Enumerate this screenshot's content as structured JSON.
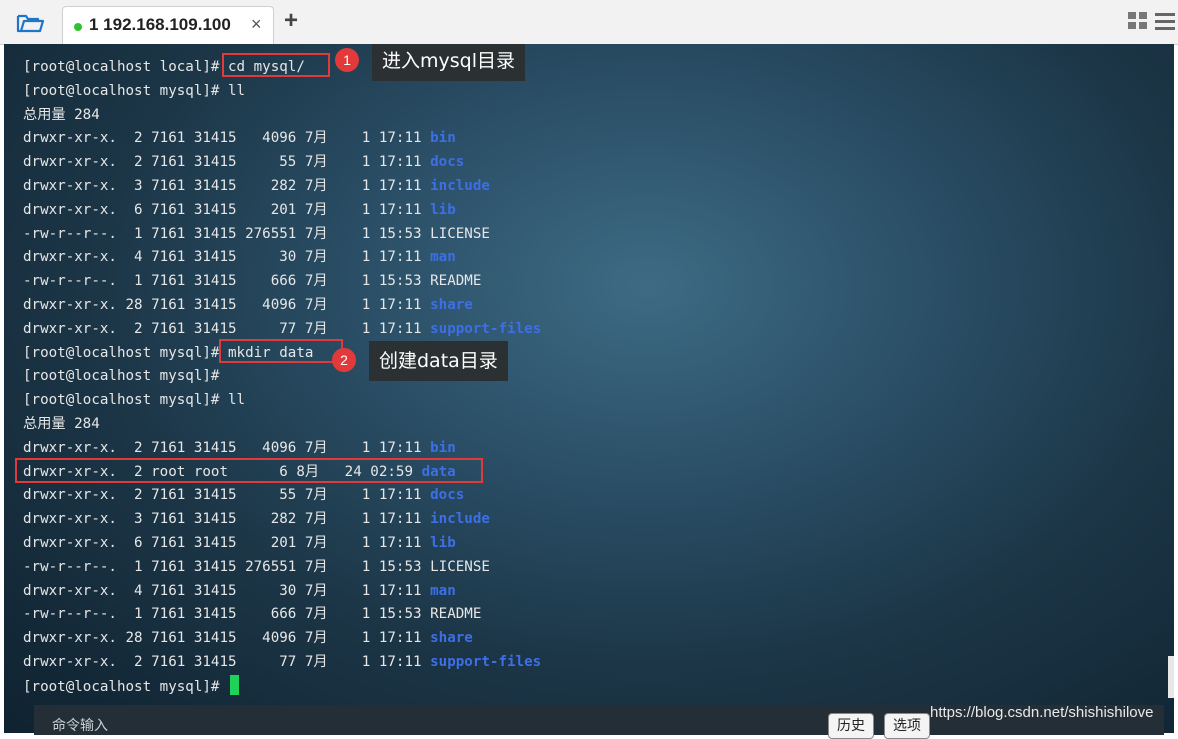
{
  "tabs": [
    {
      "title": "1 192.168.109.100",
      "status_color": "#2ec32e",
      "close": "×"
    }
  ],
  "tab_add": "+",
  "terminal": {
    "lines": [
      {
        "prompt": "[root@localhost local]# ",
        "cmd": "cd mysql/"
      },
      {
        "prompt": "[root@localhost mysql]# ",
        "cmd": "ll"
      },
      {
        "plain": "总用量 284"
      },
      {
        "meta": "drwxr-xr-x.  2 7161 31415   4096 7月    1 17:11 ",
        "name": "bin",
        "is_dir": true
      },
      {
        "meta": "drwxr-xr-x.  2 7161 31415     55 7月    1 17:11 ",
        "name": "docs",
        "is_dir": true
      },
      {
        "meta": "drwxr-xr-x.  3 7161 31415    282 7月    1 17:11 ",
        "name": "include",
        "is_dir": true
      },
      {
        "meta": "drwxr-xr-x.  6 7161 31415    201 7月    1 17:11 ",
        "name": "lib",
        "is_dir": true
      },
      {
        "meta": "-rw-r--r--.  1 7161 31415 276551 7月    1 15:53 ",
        "name": "LICENSE",
        "is_dir": false
      },
      {
        "meta": "drwxr-xr-x.  4 7161 31415     30 7月    1 17:11 ",
        "name": "man",
        "is_dir": true
      },
      {
        "meta": "-rw-r--r--.  1 7161 31415    666 7月    1 15:53 ",
        "name": "README",
        "is_dir": false
      },
      {
        "meta": "drwxr-xr-x. 28 7161 31415   4096 7月    1 17:11 ",
        "name": "share",
        "is_dir": true
      },
      {
        "meta": "drwxr-xr-x.  2 7161 31415     77 7月    1 17:11 ",
        "name": "support-files",
        "is_dir": true
      },
      {
        "prompt": "[root@localhost mysql]# ",
        "cmd": "mkdir data"
      },
      {
        "prompt": "[root@localhost mysql]# ",
        "cmd": ""
      },
      {
        "prompt": "[root@localhost mysql]# ",
        "cmd": "ll"
      },
      {
        "plain": "总用量 284"
      },
      {
        "meta": "drwxr-xr-x.  2 7161 31415   4096 7月    1 17:11 ",
        "name": "bin",
        "is_dir": true
      },
      {
        "meta": "drwxr-xr-x.  2 root root      6 8月   24 02:59 ",
        "name": "data",
        "is_dir": true
      },
      {
        "meta": "drwxr-xr-x.  2 7161 31415     55 7月    1 17:11 ",
        "name": "docs",
        "is_dir": true
      },
      {
        "meta": "drwxr-xr-x.  3 7161 31415    282 7月    1 17:11 ",
        "name": "include",
        "is_dir": true
      },
      {
        "meta": "drwxr-xr-x.  6 7161 31415    201 7月    1 17:11 ",
        "name": "lib",
        "is_dir": true
      },
      {
        "meta": "-rw-r--r--.  1 7161 31415 276551 7月    1 15:53 ",
        "name": "LICENSE",
        "is_dir": false
      },
      {
        "meta": "drwxr-xr-x.  4 7161 31415     30 7月    1 17:11 ",
        "name": "man",
        "is_dir": true
      },
      {
        "meta": "-rw-r--r--.  1 7161 31415    666 7月    1 15:53 ",
        "name": "README",
        "is_dir": false
      },
      {
        "meta": "drwxr-xr-x. 28 7161 31415   4096 7月    1 17:11 ",
        "name": "share",
        "is_dir": true
      },
      {
        "meta": "drwxr-xr-x.  2 7161 31415     77 7月    1 17:11 ",
        "name": "support-files",
        "is_dir": true
      },
      {
        "prompt": "[root@localhost mysql]# ",
        "cmd": "",
        "cursor": true
      }
    ],
    "dir_color": "#3d6fe6",
    "cursor_color": "#1fd35a"
  },
  "annotations": [
    {
      "number": "1",
      "text": "进入mysql目录"
    },
    {
      "number": "2",
      "text": "创建data目录"
    }
  ],
  "annotation_color": "#e23a3a",
  "command_bar": {
    "placeholder": "命令输入",
    "history_label": "历史",
    "options_label": "选项"
  },
  "watermark": "https://blog.csdn.net/shishishilove"
}
